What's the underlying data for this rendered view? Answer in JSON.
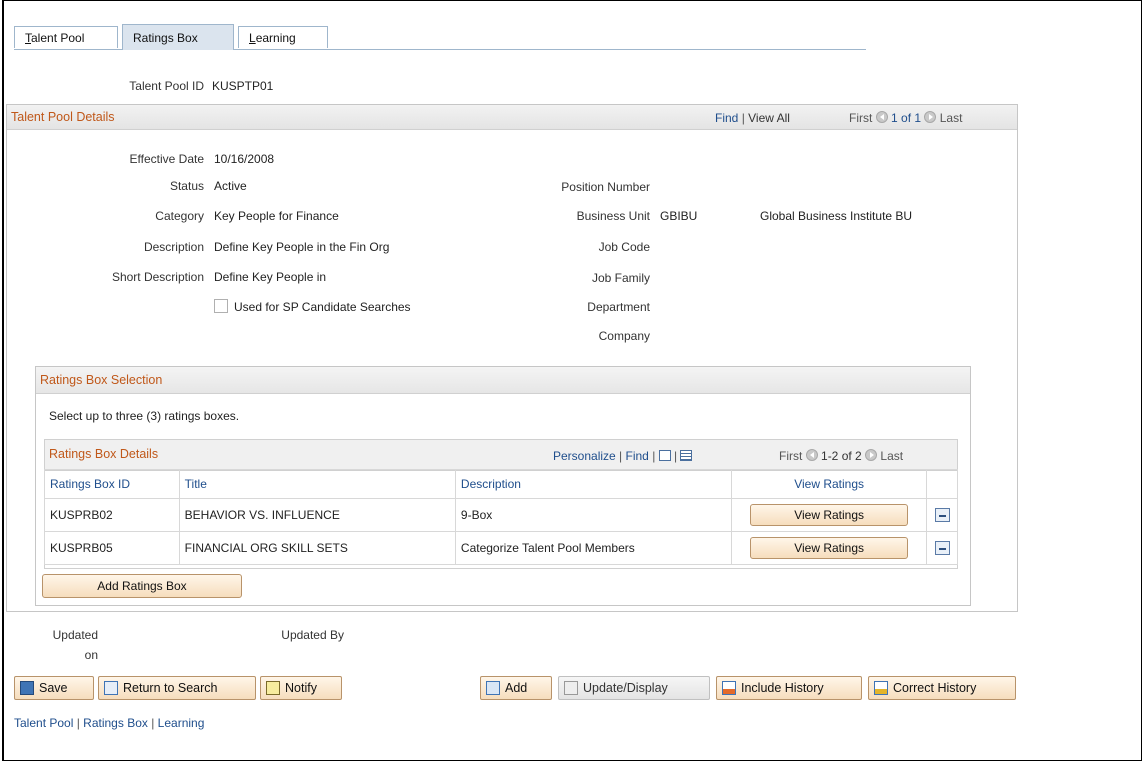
{
  "tabs": [
    {
      "label": "Talent Pool",
      "accel": "T",
      "rest": "alent Pool",
      "active": false
    },
    {
      "label": "Ratings Box",
      "active": true
    },
    {
      "label": "Learning",
      "accel": "L",
      "rest": "earning",
      "active": false
    }
  ],
  "header": {
    "talent_pool_id_label": "Talent Pool ID",
    "talent_pool_id_value": "KUSPTP01"
  },
  "details": {
    "title": "Talent Pool Details",
    "find": "Find",
    "view_all": "View All",
    "first": "First",
    "range": "1 of 1",
    "last": "Last",
    "effective_date_label": "Effective Date",
    "effective_date_value": "10/16/2008",
    "status_label": "Status",
    "status_value": "Active",
    "category_label": "Category",
    "category_value": "Key People for Finance",
    "description_label": "Description",
    "description_value": "Define Key People in the Fin Org",
    "short_description_label": "Short Description",
    "short_description_value": "Define Key People in",
    "sp_checkbox_label": "Used for SP Candidate Searches",
    "position_number_label": "Position Number",
    "business_unit_label": "Business Unit",
    "business_unit_code": "GBIBU",
    "business_unit_name": "Global Business Institute BU",
    "job_code_label": "Job Code",
    "job_family_label": "Job Family",
    "department_label": "Department",
    "company_label": "Company"
  },
  "ratings_selection": {
    "title": "Ratings Box Selection",
    "instruction": "Select up to three (3) ratings boxes.",
    "grid_title": "Ratings Box Details",
    "personalize": "Personalize",
    "find": "Find",
    "first": "First",
    "range": "1-2 of 2",
    "last": "Last",
    "columns": [
      "Ratings Box ID",
      "Title",
      "Description",
      "View Ratings"
    ],
    "rows": [
      {
        "id": "KUSPRB02",
        "title": "BEHAVIOR VS. INFLUENCE",
        "description": "9-Box",
        "button": "View Ratings"
      },
      {
        "id": "KUSPRB05",
        "title": "FINANCIAL ORG SKILL SETS",
        "description": "Categorize Talent Pool Members",
        "button": "View Ratings"
      }
    ],
    "add_button": "Add Ratings Box"
  },
  "footer_info": {
    "updated_on_label_1": "Updated",
    "updated_on_label_2": "on",
    "updated_by_label": "Updated By"
  },
  "toolbar": {
    "save": "Save",
    "return_to_search": "Return to Search",
    "notify": "Notify",
    "add": "Add",
    "update_display": "Update/Display",
    "include_history": "Include History",
    "correct_history": "Correct History"
  },
  "bottom_links": [
    "Talent Pool",
    "Ratings Box",
    "Learning"
  ],
  "colors": {
    "section_title": "#c0581a",
    "link": "#1f4e8c",
    "button_bg": "#f6ddbd",
    "tab_active_bg": "#dbe4ee"
  }
}
